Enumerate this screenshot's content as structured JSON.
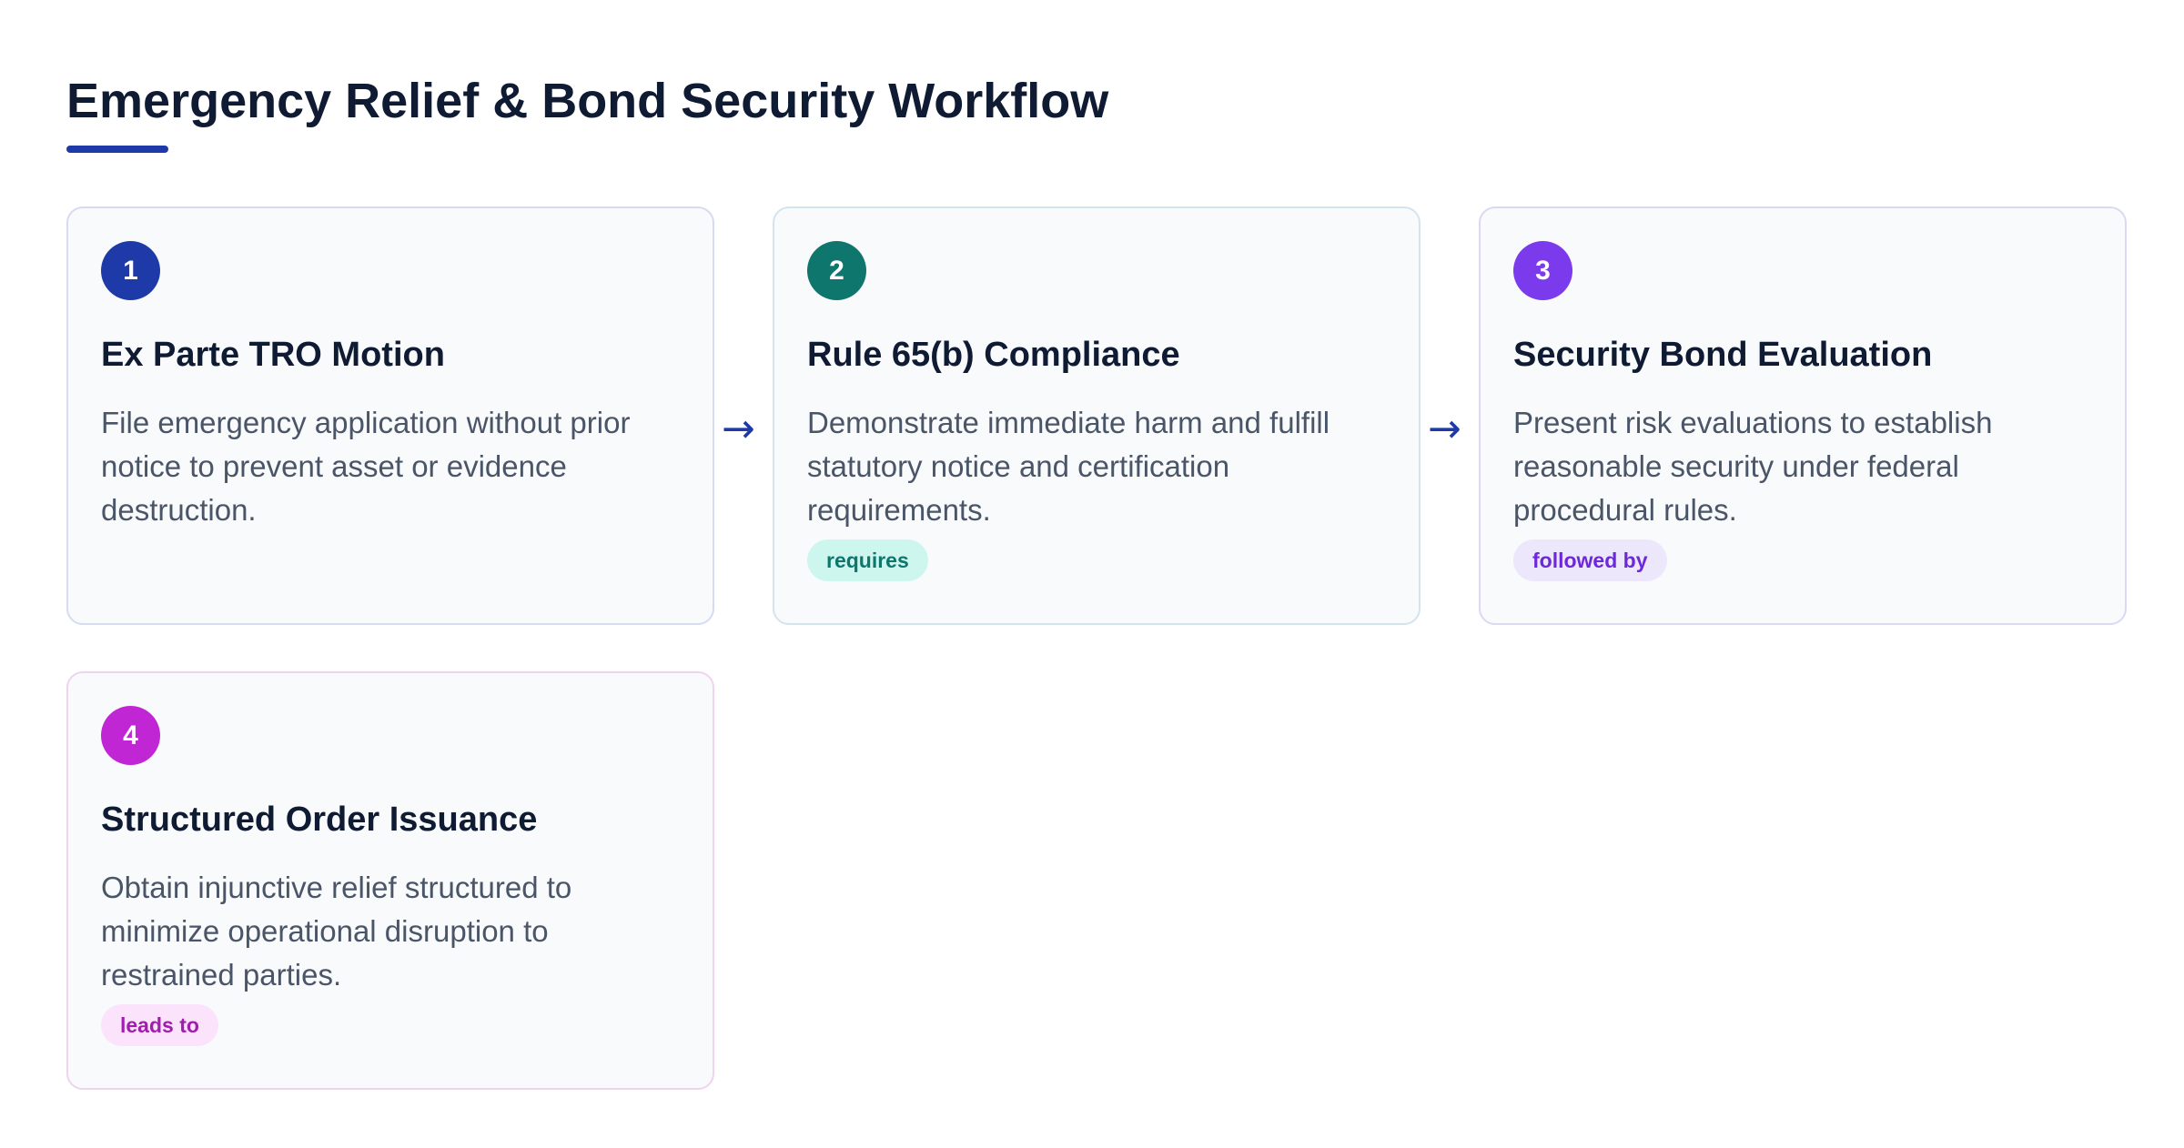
{
  "title": "Emergency Relief & Bond Security Workflow",
  "colors": {
    "accent": "#1e3aa8",
    "step1": "#1e3aa8",
    "step2": "#0f766e",
    "step3": "#7c3aed",
    "step4": "#c026d3"
  },
  "steps": [
    {
      "number": "1",
      "title": "Ex Parte TRO Motion",
      "description": "File emergency application without prior notice to prevent asset or evidence destruction.",
      "tag": ""
    },
    {
      "number": "2",
      "title": "Rule 65(b) Compliance",
      "description": "Demonstrate immediate harm and fulfill statutory notice and certification requirements.",
      "tag": "requires"
    },
    {
      "number": "3",
      "title": "Security Bond Evaluation",
      "description": "Present risk evaluations to establish reasonable security under federal procedural rules.",
      "tag": "followed by"
    },
    {
      "number": "4",
      "title": "Structured Order Issuance",
      "description": "Obtain injunctive relief structured to minimize operational disruption to restrained parties.",
      "tag": "leads to"
    }
  ],
  "arrows": [
    "→",
    "→"
  ]
}
